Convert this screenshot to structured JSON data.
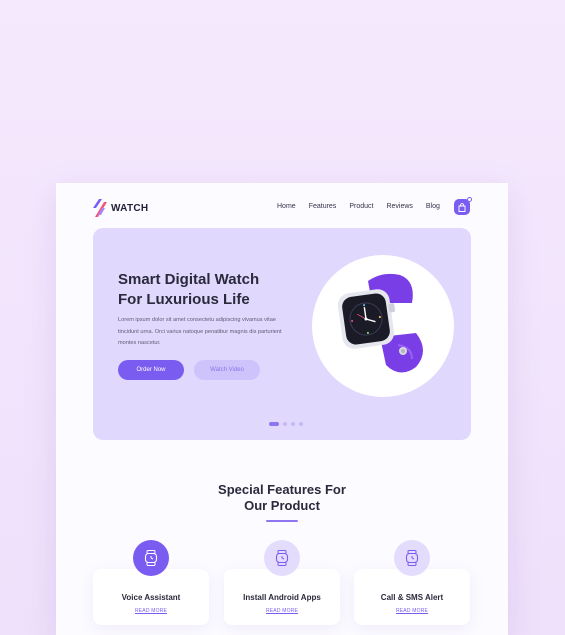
{
  "brand": {
    "name": "WATCH",
    "accent": "#7b5cf0",
    "hero_bg": "#e1d8fd"
  },
  "nav": {
    "items": [
      {
        "label": "Home"
      },
      {
        "label": "Features"
      },
      {
        "label": "Product"
      },
      {
        "label": "Reviews"
      },
      {
        "label": "Blog"
      }
    ],
    "cart_icon": "shopping-bag-icon"
  },
  "hero": {
    "title_line1": "Smart Digital Watch",
    "title_line2": "For Luxurious Life",
    "description": "Lorem ipsum dolor sit amet consectetu adipiscing vivamus vitae tincidunt urna. Orci varius natoque penatibur magnis dis parturient montes nascetur.",
    "order_label": "Order Now",
    "video_label": "Watch Video",
    "slides_total": 4,
    "active_slide": 1
  },
  "features": {
    "title_line1": "Special Features For",
    "title_line2": "Our Product",
    "cards": [
      {
        "title": "Voice Assistant",
        "link": "READ MORE",
        "icon": "watch-icon"
      },
      {
        "title": "Install Android Apps",
        "link": "READ MORE",
        "icon": "watch-icon"
      },
      {
        "title": "Call & SMS Alert",
        "link": "READ MORE",
        "icon": "watch-icon"
      }
    ]
  }
}
